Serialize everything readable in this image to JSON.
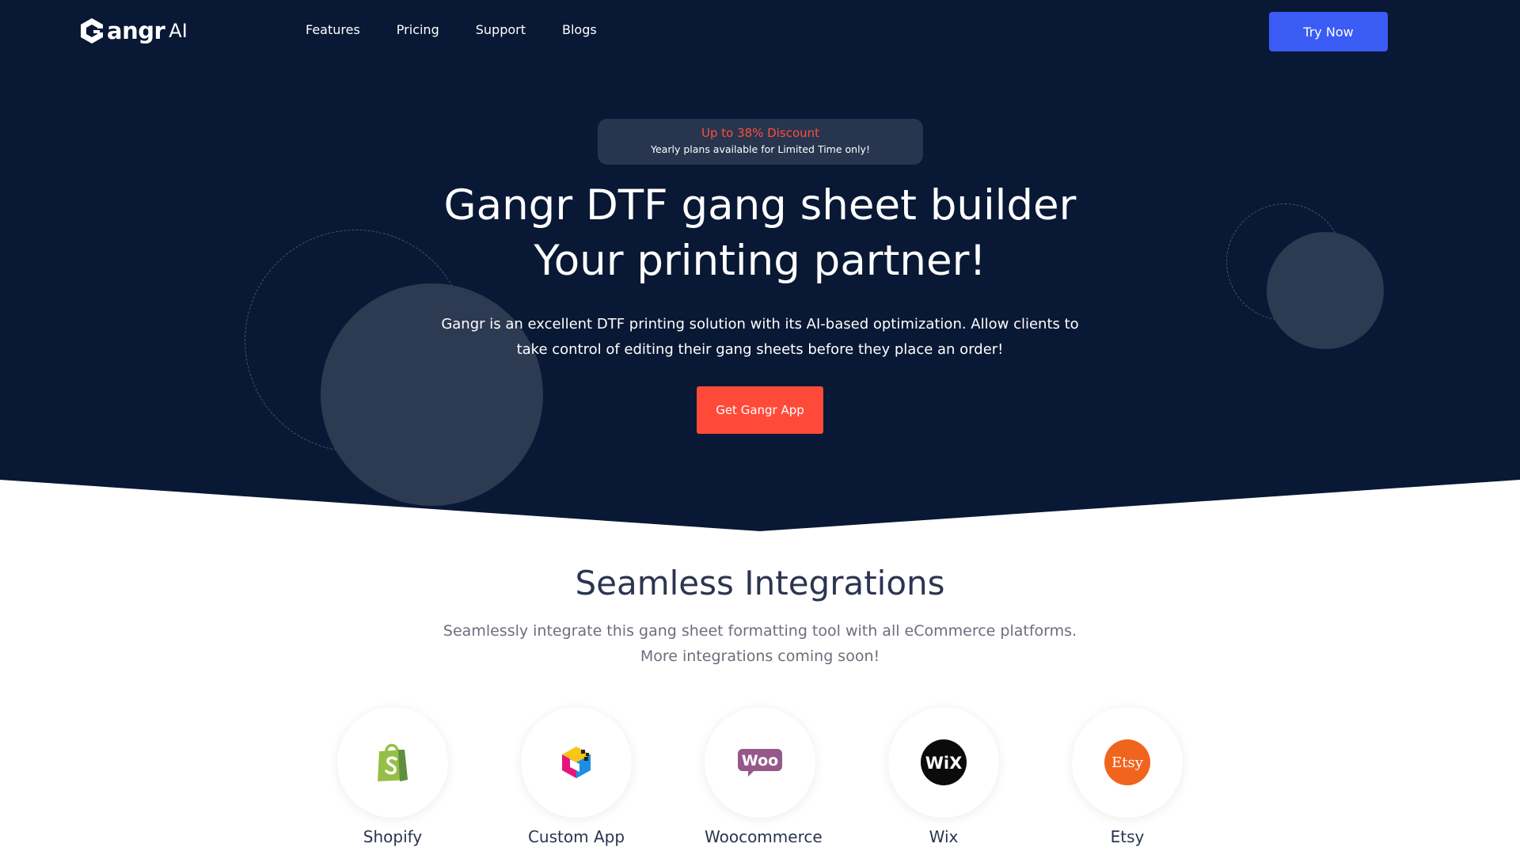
{
  "nav": {
    "logo_text": "angr",
    "logo_suffix": "AI",
    "links": [
      "Features",
      "Pricing",
      "Support",
      "Blogs"
    ],
    "try_label": "Try Now"
  },
  "hero": {
    "badge_title": "Up to 38% Discount",
    "badge_subtitle": "Yearly plans available for Limited Time only!",
    "title_line1": "Gangr DTF gang sheet builder",
    "title_line2": "Your printing partner!",
    "description": "Gangr is an excellent DTF printing solution with its AI-based optimization. Allow clients to take control of editing their gang sheets before they place an order!",
    "cta_label": "Get Gangr App"
  },
  "integrations": {
    "title": "Seamless Integrations",
    "description": "Seamlessly integrate this gang sheet formatting tool with all eCommerce platforms. More integrations coming soon!",
    "items": [
      {
        "label": "Shopify",
        "icon": "shopify-icon"
      },
      {
        "label": "Custom App",
        "icon": "custom-app-icon"
      },
      {
        "label": "Woocommerce",
        "icon": "woocommerce-icon"
      },
      {
        "label": "Wix",
        "icon": "wix-icon"
      },
      {
        "label": "Etsy",
        "icon": "etsy-icon"
      }
    ]
  },
  "colors": {
    "hero_bg": "#091834",
    "accent_blue": "#3b5bf5",
    "accent_red": "#ff4a3a",
    "heading_dark": "#2b3550"
  }
}
